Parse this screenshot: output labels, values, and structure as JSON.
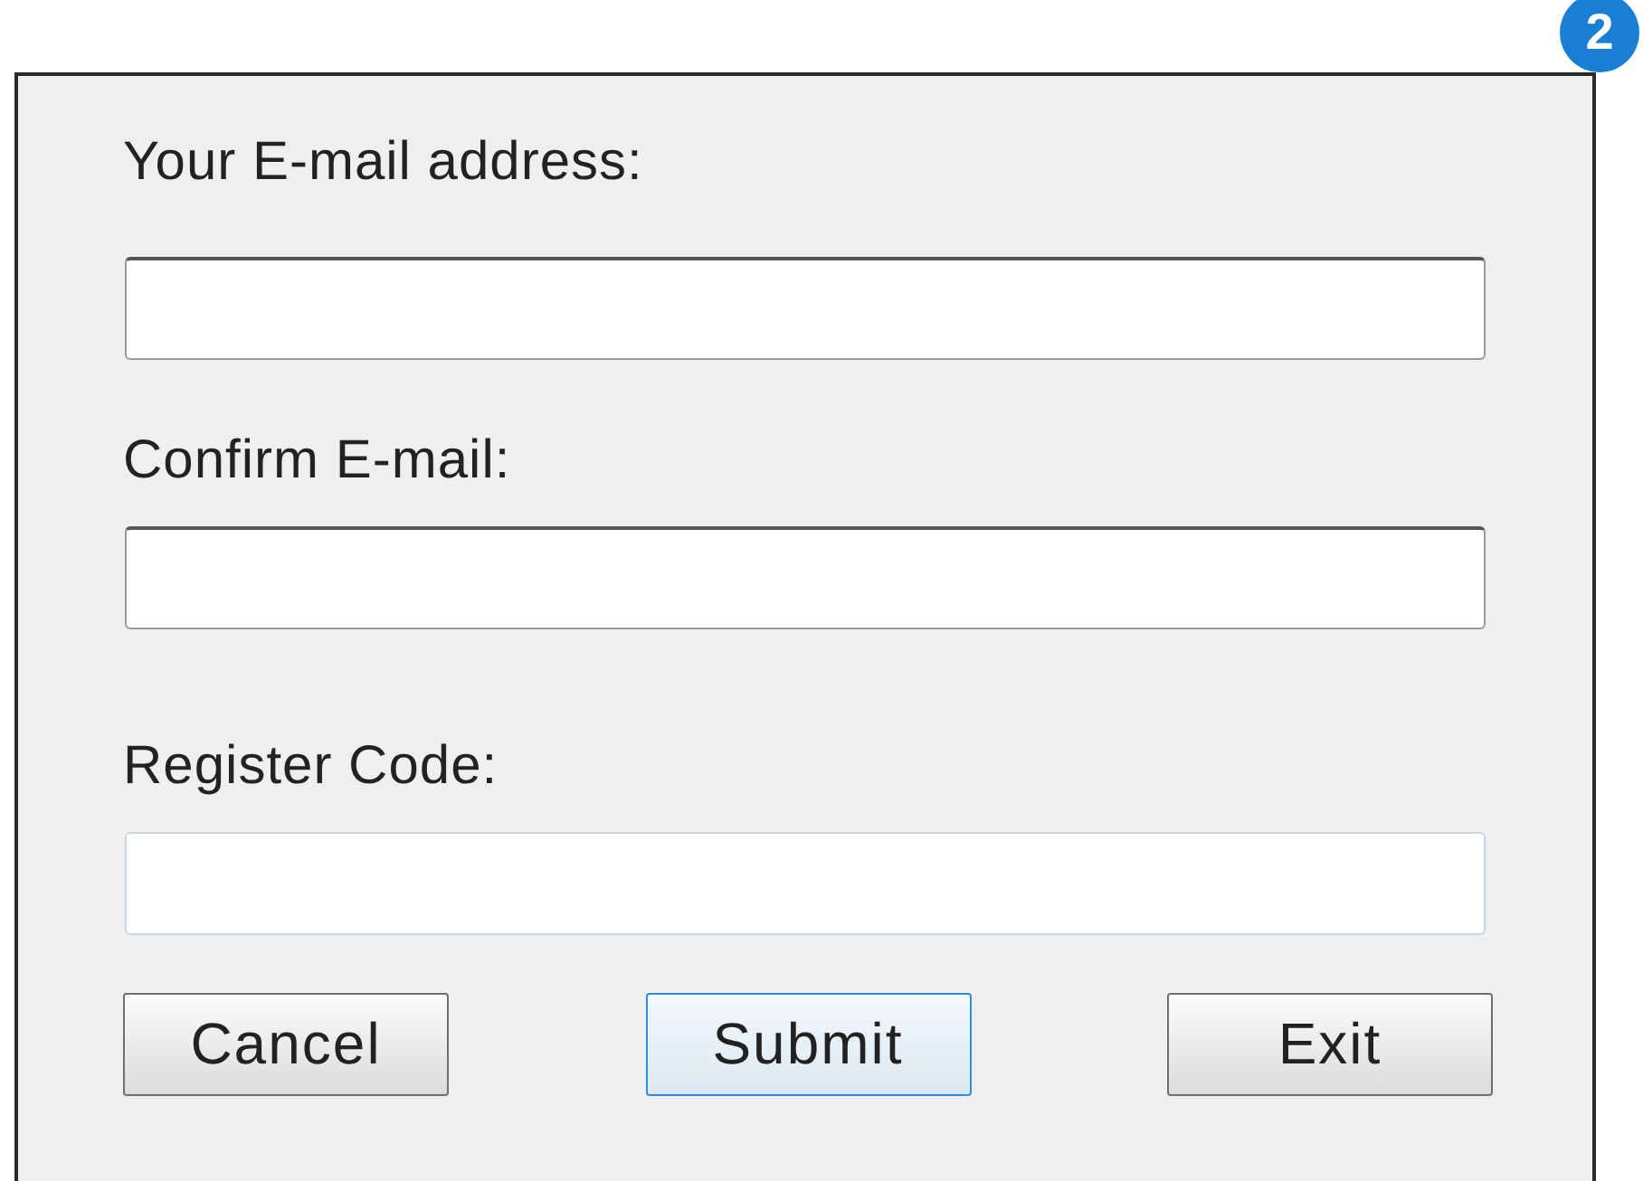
{
  "badge": "2",
  "fields": [
    {
      "label": "Your E-mail address:",
      "focused": false
    },
    {
      "label": "Confirm E-mail:",
      "focused": false
    },
    {
      "label": "Register Code:",
      "focused": true
    }
  ],
  "buttons": [
    {
      "label": "Cancel",
      "focused": false
    },
    {
      "label": "Submit",
      "focused": true
    },
    {
      "label": "Exit",
      "focused": false
    }
  ]
}
